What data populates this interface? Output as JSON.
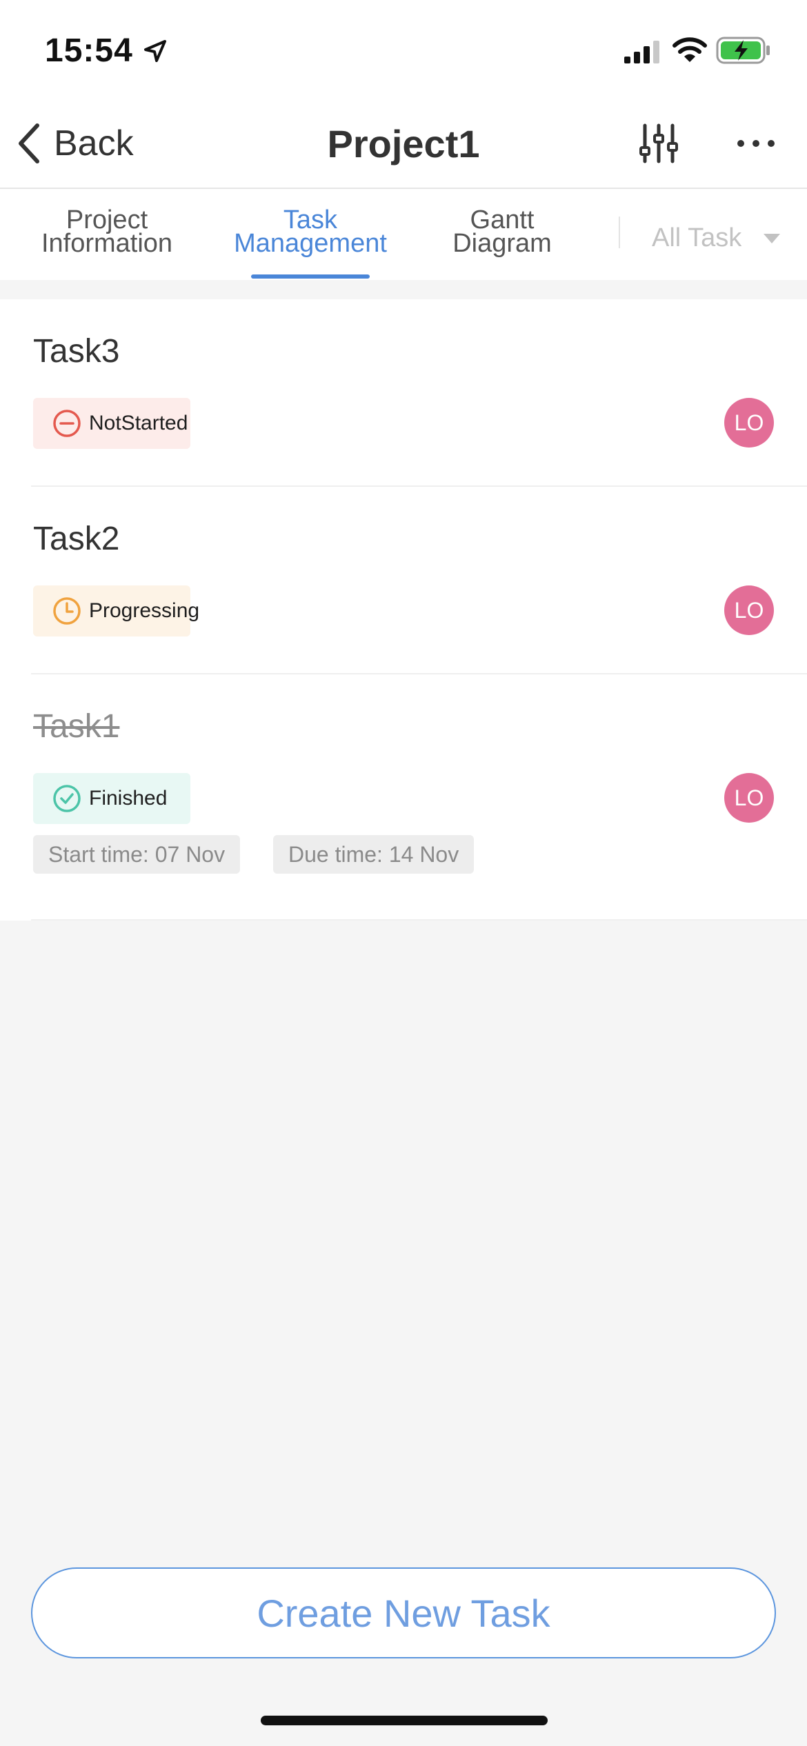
{
  "status_bar": {
    "time": "15:54"
  },
  "nav": {
    "back_label": "Back",
    "title": "Project1"
  },
  "tabs": [
    {
      "line1": "Project",
      "line2": "Information"
    },
    {
      "line1": "Task",
      "line2": "Management"
    },
    {
      "line1": "Gantt",
      "line2": "Diagram"
    }
  ],
  "active_tab": 1,
  "filter": {
    "selected": "All Task"
  },
  "tasks": [
    {
      "title": "Task3",
      "status": "NotStarted",
      "assignee": "LO",
      "finished": false
    },
    {
      "title": "Task2",
      "status": "Progressing",
      "assignee": "LO",
      "finished": false
    },
    {
      "title": "Task1",
      "status": "Finished",
      "assignee": "LO",
      "finished": true,
      "start_time": "Start time: 07 Nov",
      "due_time": "Due time: 14 Nov"
    }
  ],
  "colors": {
    "accent": "#4a86d8",
    "not_started_bg": "#fdecea",
    "not_started_icon": "#e4594e",
    "progressing_bg": "#fdf3e6",
    "progressing_icon": "#f0a23e",
    "finished_bg": "#e8f8f4",
    "finished_icon": "#4cc4a8",
    "avatar": "#e36e97"
  },
  "icons": [
    "location-arrow-icon",
    "signal-icon",
    "wifi-icon",
    "battery-charging-icon",
    "back-chevron-icon",
    "filter-sliders-icon",
    "more-dots-icon",
    "dropdown-caret-icon",
    "not-started-icon",
    "progressing-clock-icon",
    "finished-check-icon"
  ],
  "create_button_label": "Create New Task"
}
